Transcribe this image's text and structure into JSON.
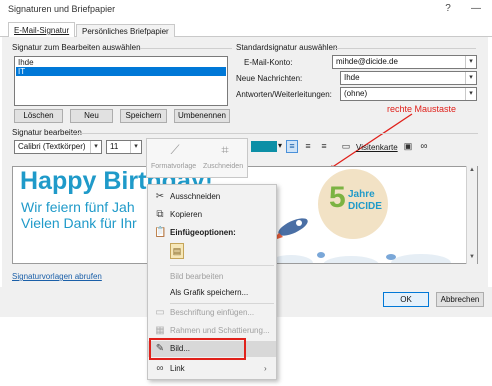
{
  "window": {
    "title": "Signaturen und Briefpapier",
    "help": "?",
    "minimize": "—"
  },
  "tabs": [
    {
      "label": "E-Mail-Signatur",
      "active": true
    },
    {
      "label": "Persönliches Briefpapier",
      "active": false
    }
  ],
  "left_panel": {
    "heading": "Signatur zum Bearbeiten auswählen",
    "list": [
      "Ihde",
      "IT"
    ],
    "selected": "IT",
    "buttons": {
      "delete": "Löschen",
      "new": "Neu",
      "save": "Speichern",
      "rename": "Umbenennen"
    }
  },
  "right_panel": {
    "heading": "Standardsignatur auswählen",
    "account_label": "E-Mail-Konto:",
    "account_value": "mihde@dicide.de",
    "new_messages_label": "Neue Nachrichten:",
    "new_messages_value": "Ihde",
    "replies_label": "Antworten/Weiterleitungen:",
    "replies_value": "(ohne)"
  },
  "editor": {
    "heading": "Signatur bearbeiten",
    "font": "Calibri (Textkörper)",
    "size": "11",
    "business_card": "Visitenkarte",
    "line1": "Happy Birthday!",
    "line2": "Wir feiern fünf Jah",
    "line3": "Vielen Dank für Ihr",
    "badge_number": "5",
    "badge_word": "Jahre",
    "badge_brand": "DICIDE"
  },
  "mini_toolbar": {
    "style": "Formatvorlage",
    "crop": "Zuschneiden"
  },
  "annotation": {
    "text": "rechte Maustaste",
    "color": "#e0211b"
  },
  "context_menu": {
    "cut": "Ausschneiden",
    "copy": "Kopieren",
    "paste_options": "Einfügeoptionen:",
    "edit_image": "Bild bearbeiten",
    "save_as_image": "Als Grafik speichern...",
    "insert_caption": "Beschriftung einfügen...",
    "borders": "Rahmen und Schattierung...",
    "picture": "Bild...",
    "link": "Link"
  },
  "footer": {
    "templates_link": "Signaturvorlagen abrufen",
    "ok": "OK",
    "cancel": "Abbrechen"
  },
  "colors": {
    "accent": "#0078d7",
    "text_blue": "#1f9ac9",
    "badge_bg": "#f2e2c5",
    "badge_green": "#7cb342",
    "highlight_border": "#e0211b"
  }
}
